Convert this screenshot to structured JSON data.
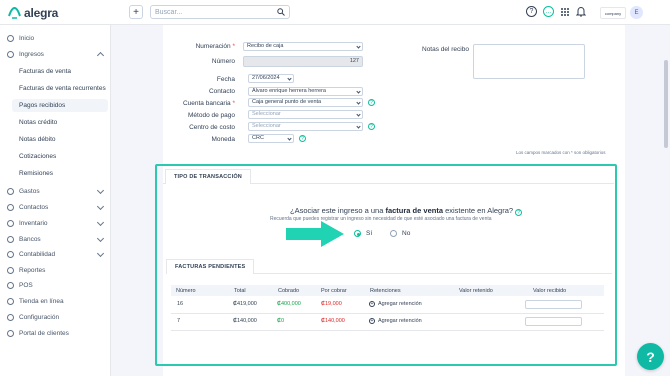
{
  "app": {
    "name": "alegra",
    "company_logo_text": "company",
    "avatar_initial": "E"
  },
  "topbar": {
    "add_label": "+",
    "search_placeholder": "Buscar..."
  },
  "sidebar": {
    "items": [
      {
        "label": "Inicio",
        "icon": "home-icon"
      },
      {
        "label": "Ingresos",
        "icon": "income-icon",
        "expanded": true
      },
      {
        "label": "Gastos",
        "icon": "expenses-icon"
      },
      {
        "label": "Contactos",
        "icon": "contacts-icon"
      },
      {
        "label": "Inventario",
        "icon": "inventory-icon"
      },
      {
        "label": "Bancos",
        "icon": "bank-icon"
      },
      {
        "label": "Contabilidad",
        "icon": "accounting-icon"
      },
      {
        "label": "Reportes",
        "icon": "reports-icon"
      },
      {
        "label": "POS",
        "icon": "pos-icon"
      },
      {
        "label": "Tienda en línea",
        "icon": "store-icon"
      },
      {
        "label": "Configuración",
        "icon": "settings-icon"
      },
      {
        "label": "Portal de clientes",
        "icon": "portal-icon"
      }
    ],
    "sub_items": [
      "Facturas de venta",
      "Facturas de venta recurrentes",
      "Pagos recibidos",
      "Notas crédito",
      "Notas débito",
      "Cotizaciones",
      "Remisiones"
    ],
    "active_sub": "Pagos recibidos"
  },
  "form": {
    "numeracion_label": "Numeración",
    "numeracion_value": "Recibo de caja",
    "numero_label": "Número",
    "numero_value": "127",
    "fecha_label": "Fecha",
    "fecha_value": "27/06/2024",
    "contacto_label": "Contacto",
    "contacto_value": "Alvaro enrique herrera herrera",
    "cuenta_label": "Cuenta bancaria",
    "cuenta_value": "Caja general punto de venta",
    "metodo_label": "Método de pago",
    "metodo_placeholder": "Seleccionar",
    "centro_label": "Centro de costo",
    "centro_placeholder": "Seleccionar",
    "moneda_label": "Moneda",
    "moneda_value": "CRC",
    "notes_label": "Notas del recibo",
    "required_note": "Los campos marcados con * son obligatorios",
    "required_mark": "*"
  },
  "transaction": {
    "tab_label": "TIPO DE TRANSACCIÓN",
    "question_prefix": "¿Asociar este ingreso a una ",
    "question_bold": "factura de venta",
    "question_suffix": " existente en Alegra?",
    "subtext": "Recuerda que puedes registrar un ingreso sin necesidad de que esté asociado una factura de venta",
    "yes_label": "Sí",
    "no_label": "No",
    "selected": "yes"
  },
  "invoices": {
    "tab_label": "FACTURAS PENDIENTES",
    "columns": [
      "Número",
      "Total",
      "Cobrado",
      "Por cobrar",
      "Retenciones",
      "Valor retenido",
      "Valor recibido"
    ],
    "rows": [
      {
        "numero": "16",
        "total": "₡419,000",
        "cobrado": "₡400,000",
        "por_cobrar": "₡19,000",
        "retenciones": "Agregar retención"
      },
      {
        "numero": "7",
        "total": "₡140,000",
        "cobrado": "₡0",
        "por_cobrar": "₡140,000",
        "retenciones": "Agregar retención"
      }
    ]
  },
  "colors": {
    "accent": "#0dbf9d",
    "highlight_frame": "#2cc8b0",
    "arrow": "#1fd3b3",
    "fab": "#10b9a4"
  },
  "help_fab_label": "?"
}
